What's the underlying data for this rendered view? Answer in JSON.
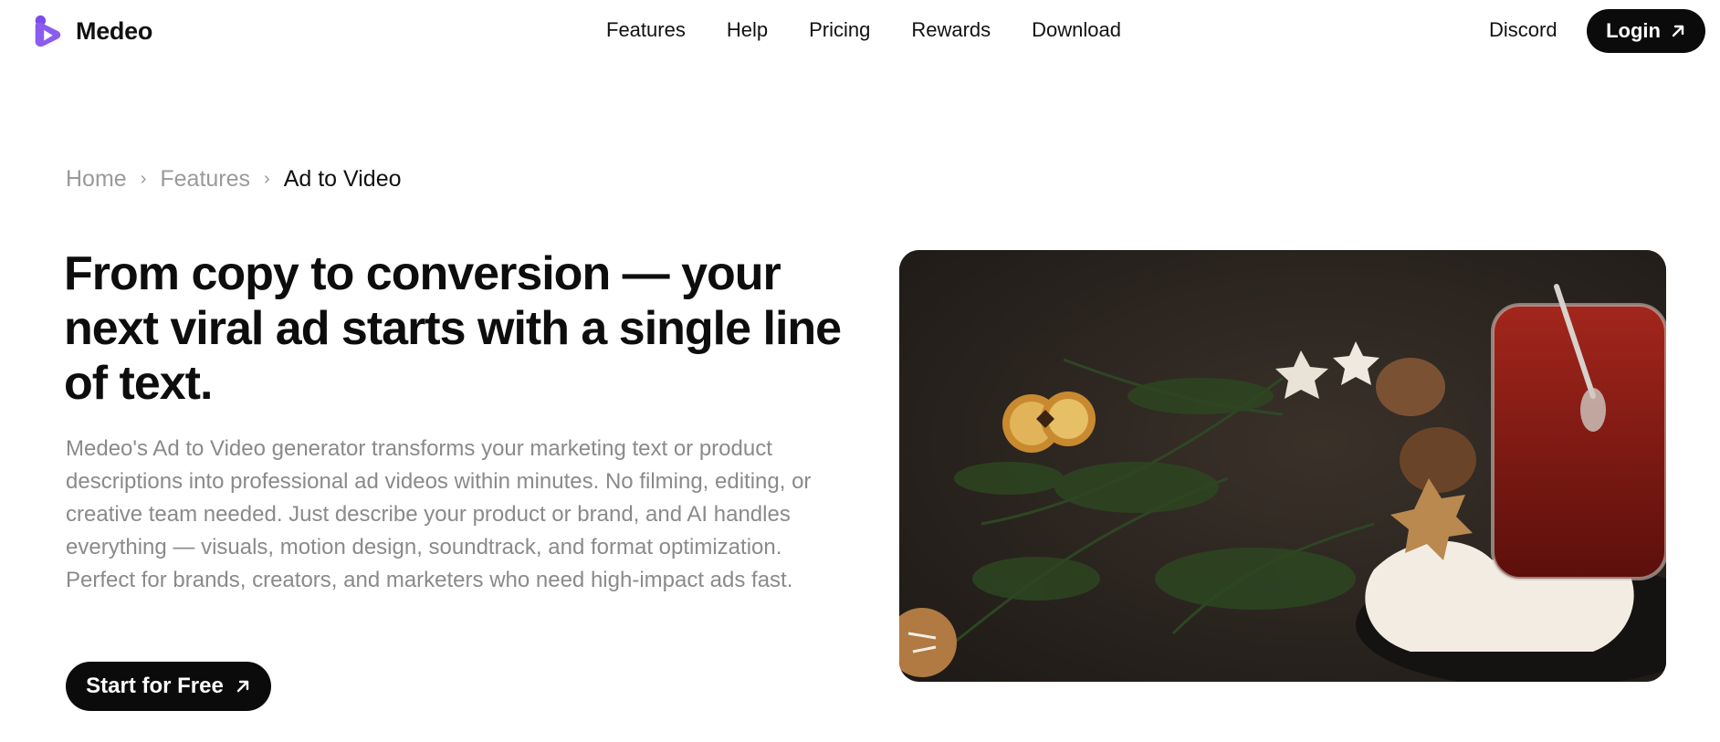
{
  "brand": {
    "name": "Medeo",
    "accent": "#7b4dea"
  },
  "nav": {
    "items": [
      "Features",
      "Help",
      "Pricing",
      "Rewards",
      "Download"
    ],
    "discord": "Discord",
    "login": "Login"
  },
  "breadcrumb": {
    "home": "Home",
    "features": "Features",
    "current": "Ad to Video"
  },
  "hero": {
    "headline": "From copy to conversion — your next viral ad starts with a single line of text.",
    "description": "Medeo's Ad to Video generator transforms your marketing text or product descriptions into professional ad videos within minutes. No filming, editing, or creative team needed. Just describe your product or brand, and AI handles everything — visuals, motion design, soundtrack, and format optimization. Perfect for brands, creators, and marketers who need high-impact ads fast.",
    "cta": "Start for Free"
  },
  "icons": {
    "login_arrow": "arrow-up-right-icon",
    "cta_arrow": "arrow-up-right-icon"
  }
}
